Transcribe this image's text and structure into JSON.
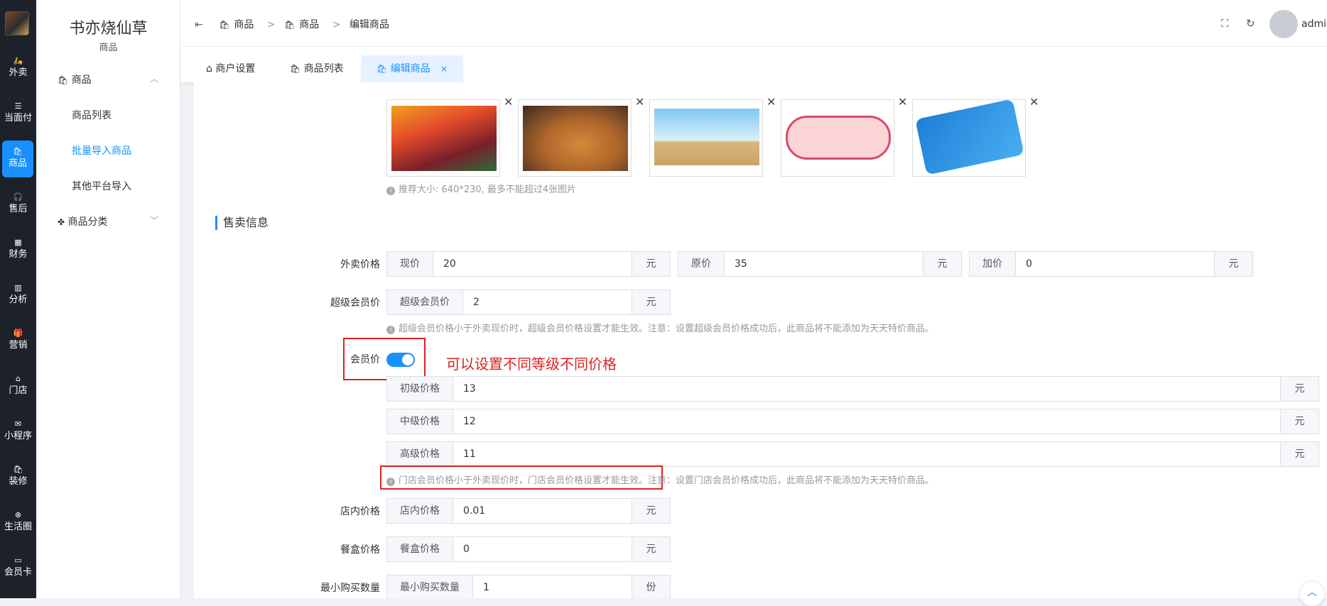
{
  "rail": {
    "items": [
      {
        "icon": "takeout-icon",
        "glyph": "🛵",
        "label": "外卖"
      },
      {
        "icon": "face-pay-icon",
        "glyph": "☰",
        "label": "当面付"
      },
      {
        "icon": "goods-icon",
        "glyph": "🛍",
        "label": "商品"
      },
      {
        "icon": "headset-icon",
        "glyph": "🎧",
        "label": "售后"
      },
      {
        "icon": "finance-icon",
        "glyph": "▦",
        "label": "财务"
      },
      {
        "icon": "analysis-icon",
        "glyph": "▥",
        "label": "分析"
      },
      {
        "icon": "gift-icon",
        "glyph": "🎁",
        "label": "营销"
      },
      {
        "icon": "store-icon",
        "glyph": "⌂",
        "label": "门店"
      },
      {
        "icon": "wechat-icon",
        "glyph": "✉",
        "label": "小程序"
      },
      {
        "icon": "decorate-icon",
        "glyph": "🛍",
        "label": "装修"
      },
      {
        "icon": "life-circle-icon",
        "glyph": "⊗",
        "label": "生活圈"
      },
      {
        "icon": "member-card-icon",
        "glyph": "▭",
        "label": "会员卡"
      }
    ]
  },
  "sidebar": {
    "store_name": "书亦烧仙草",
    "store_sub": "商品",
    "group_goods": "商品",
    "items": [
      "商品列表",
      "批量导入商品",
      "其他平台导入"
    ],
    "group_category": "商品分类"
  },
  "header": {
    "crumbs": [
      "商品",
      "商品",
      "编辑商品"
    ],
    "username": "admin"
  },
  "tabs": [
    {
      "label": "商户设置"
    },
    {
      "label": "商品列表"
    },
    {
      "label": "编辑商品",
      "close": "×"
    }
  ],
  "form": {
    "img_hint": "推荐大小: 640*230, 最多不能超过4张图片",
    "section_title": "售卖信息",
    "takeout_price_label": "外卖价格",
    "current_prefix": "现价",
    "current_value": "20",
    "original_prefix": "原价",
    "original_value": "35",
    "markup_prefix": "加价",
    "markup_value": "0",
    "yuan": "元",
    "super_label": "超级会员价",
    "super_prefix": "超级会员价",
    "super_value": "2",
    "super_hint": "超级会员价格小于外卖现价时，超级会员价格设置才能生效。注意：设置超级会员价格成功后，此商品将不能添加为天天特价商品。",
    "member_label": "会员价",
    "member_enabled": true,
    "annotation": "可以设置不同等级不同价格",
    "levels": [
      {
        "prefix": "初级价格",
        "value": "13"
      },
      {
        "prefix": "中级价格",
        "value": "12"
      },
      {
        "prefix": "高级价格",
        "value": "11"
      }
    ],
    "member_hint": "门店会员价格小于外卖现价时，门店会员价格设置才能生效。注意：设置门店会员价格成功后，此商品将不能添加为天天特价商品。",
    "instore_label": "店内价格",
    "instore_prefix": "店内价格",
    "instore_value": "0.01",
    "box_label": "餐盒价格",
    "box_prefix": "餐盒价格",
    "box_value": "0",
    "min_label": "最小购买数量",
    "min_prefix": "最小购买数量",
    "min_value": "1",
    "unit_fen": "份"
  },
  "colors": {
    "accent": "#1890ff",
    "annotation": "#e02020",
    "rail": "#1d2129"
  }
}
